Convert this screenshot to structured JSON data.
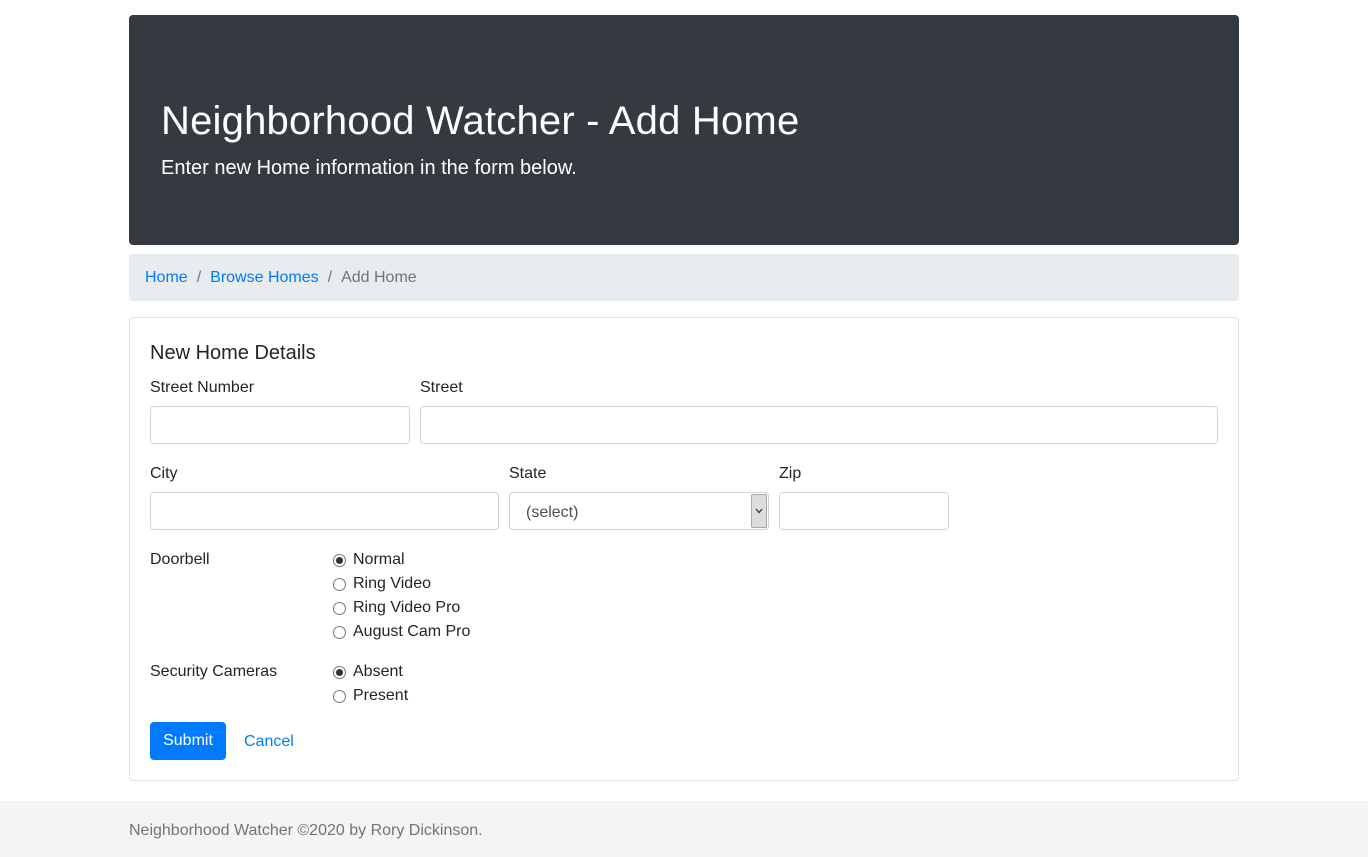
{
  "header": {
    "title": "Neighborhood Watcher - Add Home",
    "lead": "Enter new Home information in the form below."
  },
  "breadcrumb": {
    "items": [
      "Home",
      "Browse Homes"
    ],
    "active": "Add Home",
    "separator": "/"
  },
  "form": {
    "title": "New Home Details",
    "street_number_label": "Street Number",
    "street_number_value": "",
    "street_label": "Street",
    "street_value": "",
    "city_label": "City",
    "city_value": "",
    "state_label": "State",
    "state_value": "(select)",
    "zip_label": "Zip",
    "zip_value": "",
    "doorbell_label": "Doorbell",
    "doorbell_options": [
      "Normal",
      "Ring Video",
      "Ring Video Pro",
      "August Cam Pro"
    ],
    "doorbell_selected": "Normal",
    "cameras_label": "Security Cameras",
    "cameras_options": [
      "Absent",
      "Present"
    ],
    "cameras_selected": "Absent",
    "submit_label": "Submit",
    "cancel_label": "Cancel"
  },
  "footer": {
    "text": "Neighborhood Watcher ©2020 by Rory Dickinson."
  },
  "colors": {
    "header_bg": "#343a40",
    "breadcrumb_bg": "#e9ecef",
    "primary": "#007bff",
    "footer_bg": "#f4f4f4"
  },
  "icons": {
    "select_arrow": "chevron-down-icon"
  }
}
